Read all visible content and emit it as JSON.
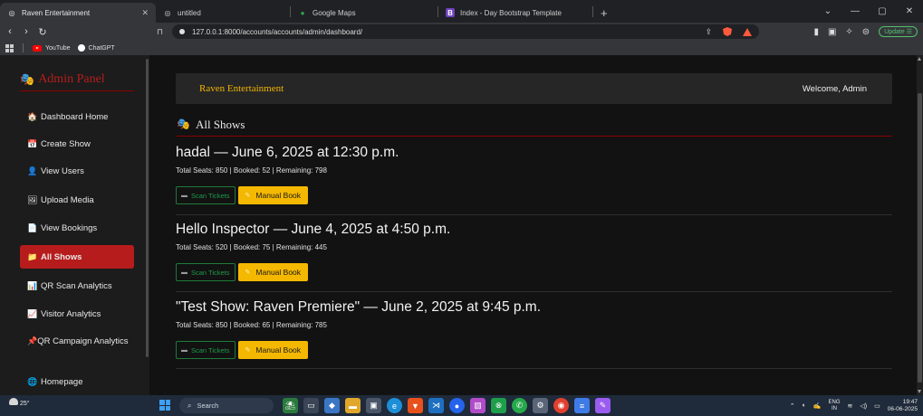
{
  "browser": {
    "tabs": [
      {
        "label": "Raven Entertainment",
        "active": true
      },
      {
        "label": "untitled",
        "active": false
      },
      {
        "label": "Google Maps",
        "active": false
      },
      {
        "label": "Index - Day Bootstrap Template",
        "active": false
      }
    ],
    "url": "127.0.0.1:8000/accounts/accounts/admin/dashboard/",
    "update_label": "Update",
    "bookmarks": [
      {
        "label": "YouTube",
        "icon": "youtube-icon"
      },
      {
        "label": "ChatGPT",
        "icon": "chatgpt-icon"
      }
    ]
  },
  "sidebar": {
    "brand": "Admin Panel",
    "items": [
      {
        "label": "Dashboard Home",
        "icon": "home-icon",
        "glyph": "🏠",
        "active": false
      },
      {
        "label": "Create Show",
        "icon": "calendar-icon",
        "glyph": "📅",
        "active": false
      },
      {
        "label": "View Users",
        "icon": "user-icon",
        "glyph": "👤",
        "active": false
      },
      {
        "label": "Upload Media",
        "icon": "image-icon",
        "glyph": "🖼",
        "active": false
      },
      {
        "label": "View Bookings",
        "icon": "document-icon",
        "glyph": "📄",
        "active": false
      },
      {
        "label": "All Shows",
        "icon": "folder-icon",
        "glyph": "📁",
        "active": true
      },
      {
        "label": "QR Scan Analytics",
        "icon": "bar-chart-icon",
        "glyph": "📊",
        "active": false
      },
      {
        "label": "Visitor Analytics",
        "icon": "line-chart-icon",
        "glyph": "📈",
        "active": false
      },
      {
        "label": "QR Campaign Analytics",
        "icon": "pin-icon",
        "glyph": "📌",
        "active": false
      },
      {
        "label": "Homepage",
        "icon": "globe-icon",
        "glyph": "🌐",
        "active": false
      }
    ]
  },
  "header": {
    "brand": "Raven Entertainment",
    "welcome": "Welcome, Admin"
  },
  "section": {
    "title": "All Shows"
  },
  "shows": [
    {
      "title": "hadal — June 6, 2025 at 12:30 p.m.",
      "stats": "Total Seats: 850 | Booked: 52 | Remaining: 798",
      "scan_label": "Scan Tickets",
      "manual_label": "Manual Book"
    },
    {
      "title": "Hello Inspector — June 4, 2025 at 4:50 p.m.",
      "stats": "Total Seats: 520 | Booked: 75 | Remaining: 445",
      "scan_label": "Scan Tickets",
      "manual_label": "Manual Book"
    },
    {
      "title": "\"Test Show: Raven Premiere\" — June 2, 2025 at 9:45 p.m.",
      "stats": "Total Seats: 850 | Booked: 65 | Remaining: 785",
      "scan_label": "Scan Tickets",
      "manual_label": "Manual Book"
    }
  ],
  "taskbar": {
    "weather": "25°",
    "search_placeholder": "Search",
    "lang_top": "ENG",
    "lang_bottom": "IN",
    "time": "19:47",
    "date": "06-06-2025"
  }
}
